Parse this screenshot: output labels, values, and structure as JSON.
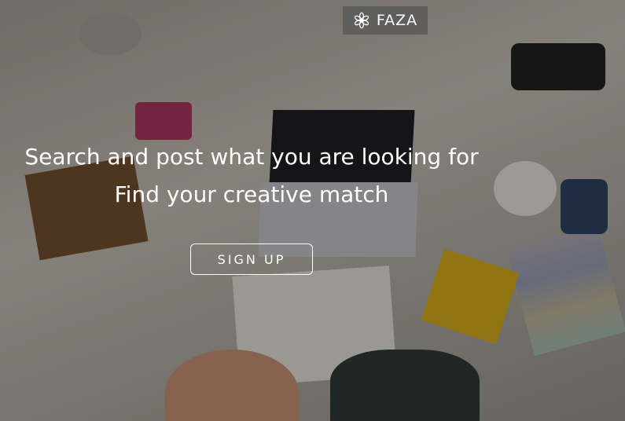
{
  "brand": {
    "name": "FAZA",
    "icon": "flower-asterisk-icon"
  },
  "hero": {
    "headline": "Search and post what you are looking for",
    "subheadline": "Find your creative match",
    "cta_label": "SIGN UP"
  },
  "colors": {
    "overlay": "#000000",
    "text": "#ffffff",
    "logo_bg": "#5a5a5a"
  }
}
